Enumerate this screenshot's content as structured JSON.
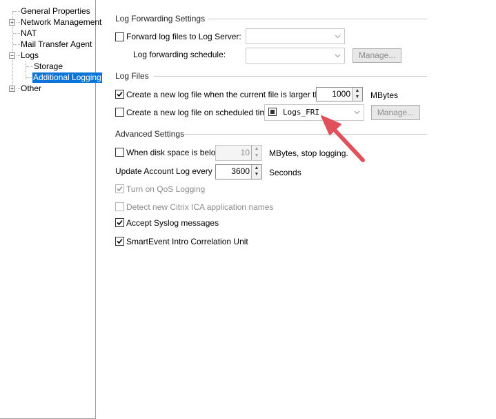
{
  "tree": {
    "general_properties": "General Properties",
    "network_management": "Network Management",
    "nat": "NAT",
    "mail_transfer_agent": "Mail Transfer Agent",
    "logs": "Logs",
    "storage": "Storage",
    "additional_logging": "Additional Logging",
    "other": "Other",
    "expander_plus": "+",
    "expander_minus": "−"
  },
  "log_forwarding": {
    "title": "Log Forwarding Settings",
    "forward_label": "Forward log files to Log Server:",
    "forward_checked": false,
    "schedule_label": "Log forwarding schedule:",
    "manage_label": "Manage..."
  },
  "log_files": {
    "title": "Log Files",
    "larger_label": "Create a new log file when the current file is larger than",
    "larger_checked": true,
    "larger_value": "1000",
    "larger_unit": "MBytes",
    "scheduled_label": "Create a new log file on scheduled times",
    "scheduled_checked": false,
    "scheduled_value": "Logs_FRI",
    "manage_label": "Manage..."
  },
  "advanced": {
    "title": "Advanced Settings",
    "disk_label": "When disk space is below",
    "disk_checked": false,
    "disk_value": "10",
    "disk_unit": "MBytes, stop logging.",
    "account_label": "Update Account Log every",
    "account_value": "3600",
    "account_unit": "Seconds",
    "qos_label": "Turn on QoS Logging",
    "qos_checked": true,
    "citrix_label": "Detect new Citrix ICA application names",
    "citrix_checked": false,
    "syslog_label": "Accept Syslog messages",
    "syslog_checked": true,
    "smartevent_label": "SmartEvent Intro Correlation Unit",
    "smartevent_checked": true
  },
  "colors": {
    "selection": "#0a74d8",
    "arrow": "#e0515b",
    "disabled_text": "#8c8c8c"
  },
  "icons": {
    "spin_up": "▲",
    "spin_down": "▼"
  }
}
